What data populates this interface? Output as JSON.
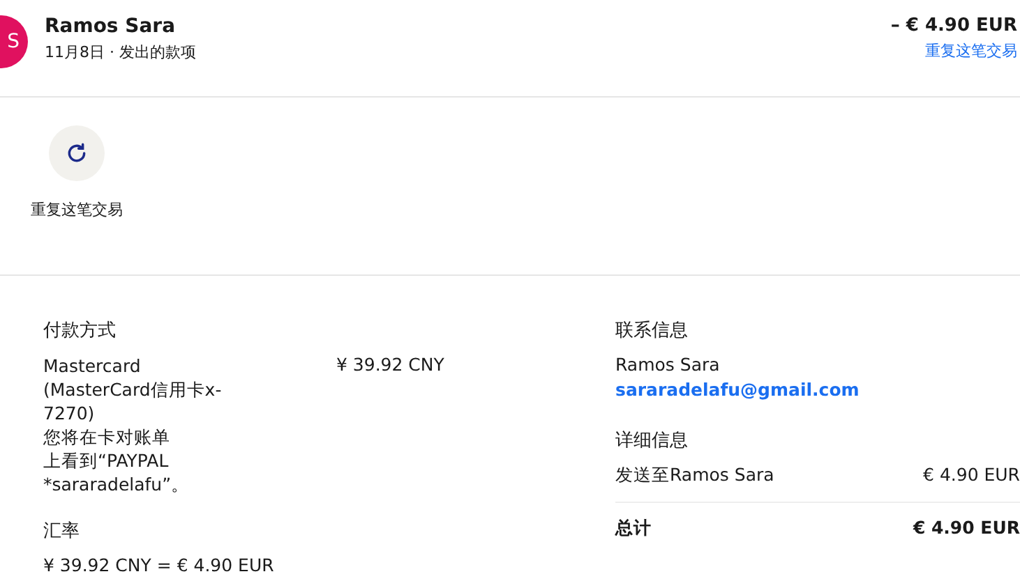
{
  "header": {
    "avatar_letter": "S",
    "name": "Ramos Sara",
    "date": "11月8日",
    "separator": "·",
    "type": "发出的款项",
    "amount": "– € 4.90 EUR",
    "repeat_link": "重复这笔交易"
  },
  "actions": [
    {
      "label": "重复这笔交易"
    }
  ],
  "payment": {
    "heading": "付款方式",
    "method_lines": [
      "Mastercard",
      "(MasterCard信用卡x-",
      "7270)",
      "您将在卡对账单",
      "上看到“PAYPAL",
      "*sararadelafu”。"
    ],
    "amount": "¥ 39.92 CNY"
  },
  "exchange": {
    "heading": "汇率",
    "rate": "¥ 39.92 CNY = € 4.90 EUR"
  },
  "contact": {
    "heading": "联系信息",
    "name": "Ramos Sara",
    "email": "sararadelafu@gmail.com"
  },
  "details": {
    "heading": "详细信息",
    "rows": [
      {
        "label": "发送至Ramos Sara",
        "amount": "€ 4.90 EUR",
        "kind": "line"
      },
      {
        "label": "总计",
        "amount": "€ 4.90 EUR",
        "kind": "total"
      }
    ]
  }
}
